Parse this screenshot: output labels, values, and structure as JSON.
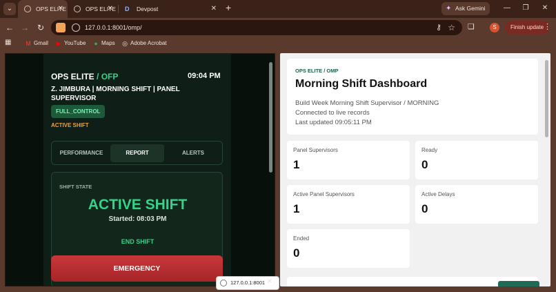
{
  "browser": {
    "tabs": [
      {
        "title": "OPS ELITE",
        "active": true
      },
      {
        "title": "OPS ELITE",
        "active": false
      },
      {
        "title": "Devpost",
        "active": false
      }
    ],
    "ask_gemini": "Ask Gemini",
    "url": "127.0.0.1:8001/omp/",
    "profile_initial": "S",
    "finish_update": "Finish update",
    "bookmarks": [
      {
        "label": "Gmail",
        "icon": "gmail-icon"
      },
      {
        "label": "YouTube",
        "icon": "youtube-icon"
      },
      {
        "label": "Maps",
        "icon": "maps-icon"
      },
      {
        "label": "Adobe Acrobat",
        "icon": "acrobat-icon"
      }
    ],
    "download_label": "127.0.0.1:8001"
  },
  "ofp": {
    "brand": "OPS ELITE",
    "brand_suffix": "/ OFP",
    "time": "09:04 PM",
    "user_line": "Z. JIMBURA | MORNING SHIFT | PANEL SUPERVISOR",
    "badge": "FULL_CONTROL",
    "active_label": "ACTIVE SHIFT",
    "tabs": [
      "PERFORMANCE",
      "REPORT",
      "ALERTS"
    ],
    "selected_tab": "REPORT",
    "state_label": "SHIFT STATE",
    "state_value": "ACTIVE SHIFT",
    "started": "Started: 08:03 PM",
    "end_shift": "END SHIFT",
    "emergency": "EMERGENCY"
  },
  "omp": {
    "kicker": "OPS ELITE / OMP",
    "title": "Morning Shift Dashboard",
    "subtitle_lines": [
      "Build Week Morning Shift Supervisor / MORNING",
      "Connected to live records",
      "Last updated 09:05:11 PM"
    ],
    "stats": [
      {
        "label": "Panel Supervisors",
        "value": "1"
      },
      {
        "label": "Ready",
        "value": "0"
      },
      {
        "label": "Active Panel Supervisors",
        "value": "1"
      },
      {
        "label": "Active Delays",
        "value": "0"
      },
      {
        "label": "Ended",
        "value": "0"
      }
    ]
  },
  "colors": {
    "accent_green": "#35d28a",
    "shift_orange": "#f2a13a",
    "emergency_red": "#c8373a",
    "browser_frame": "#5a3a2c"
  }
}
